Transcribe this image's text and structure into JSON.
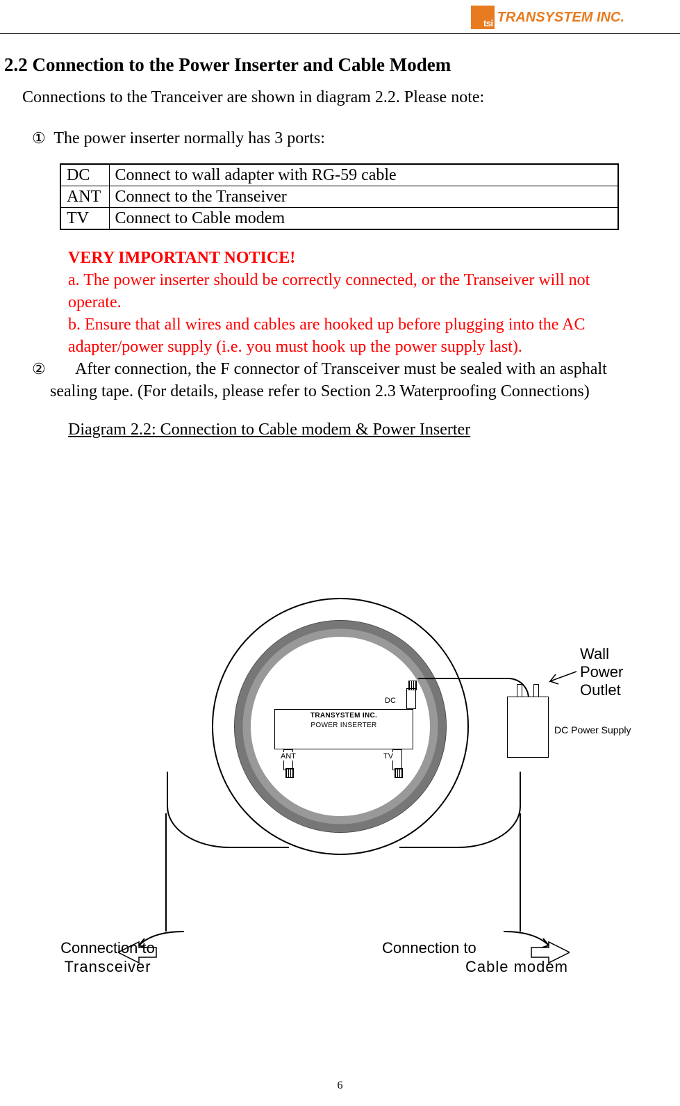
{
  "header": {
    "company": "TRANSYSTEM INC."
  },
  "section": {
    "heading": "2.2 Connection to the Power Inserter and Cable Modem",
    "intro": "Connections to the Tranceiver are shown in diagram 2.2. Please note:",
    "item1": "The power inserter normally has 3 ports:",
    "item2": "After connection, the F connector of Transceiver must be sealed with an asphalt sealing tape. (For details, please refer to Section 2.3 Waterproofing Connections)"
  },
  "ports": [
    {
      "port": "DC",
      "desc": "Connect to wall adapter with RG-59 cable"
    },
    {
      "port": "ANT",
      "desc": "Connect to the Transeiver"
    },
    {
      "port": "TV",
      "desc": "Connect to Cable modem"
    }
  ],
  "notice": {
    "title": "VERY IMPORTANT NOTICE!",
    "a": "a. The power inserter should be correctly connected, or the Transeiver will not operate.",
    "b": "b. Ensure that all wires and cables are hooked up before plugging into the AC adapter/power supply (i.e. you must hook up the power supply last)."
  },
  "diagram": {
    "title": "Diagram 2.2: Connection to Cable modem & Power Inserter",
    "inserter_brand": "TRANSYSTEM INC.",
    "inserter_label": "POWER INSERTER",
    "port_dc": "DC",
    "port_ant": "ANT",
    "port_tv": "TV",
    "wall_label": "Wall\nPower\nOutlet",
    "dc_supply": "DC Power Supply",
    "conn_left": "Connection to",
    "conn_left_sub": "Transceiver",
    "conn_right": "Connection to",
    "conn_right_sub": "Cable modem"
  },
  "page_number": "6"
}
